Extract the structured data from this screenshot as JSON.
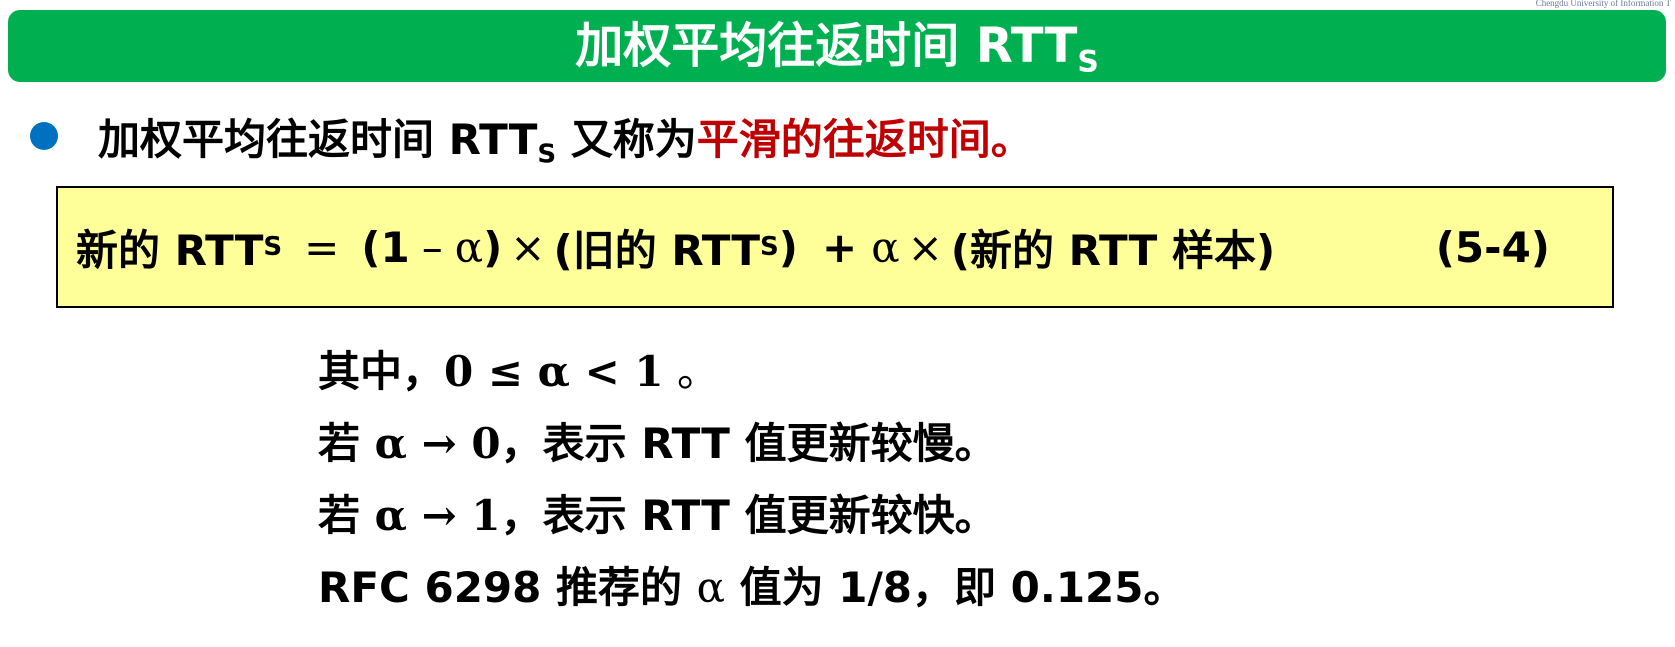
{
  "logo": {
    "text": "Chengdu University of Information T"
  },
  "title": {
    "main": "加权平均往返时间 RTT",
    "subscript": "S"
  },
  "bullet": {
    "prefix": "加权平均往返时间 RTT",
    "subscript": "S",
    "middle": " 又称为",
    "highlight": "平滑的往返时间。",
    "highlight_color": "#c00000"
  },
  "formula": {
    "lhs": "新的 RTT",
    "lhs_sub": "S",
    "equals": "=",
    "p1_open": "(1",
    "minus": "–",
    "alpha": "α",
    "p1_close": ")",
    "times": "×",
    "old_open": "(旧的 RTT",
    "old_sub": "S",
    "old_close": ")",
    "plus": "+",
    "new_sample": "(新的 RTT 样本)",
    "eq_number": "(5-4)"
  },
  "notes": {
    "line1": {
      "pre": "其中，",
      "math": "0 ≤ α < 1",
      "post": " 。"
    },
    "line2": {
      "pre": "若 ",
      "math": "α → 0",
      "post": "，表示 RTT 值更新较慢。"
    },
    "line3": {
      "pre": "若 ",
      "math": "α → 1",
      "post": "，表示 RTT 值更新较快。"
    },
    "line4": {
      "pre": "RFC 6298 推荐的 ",
      "math": "α",
      "post": " 值为 1/8，即 0.125。"
    }
  },
  "colors": {
    "title_bar": "#00b050",
    "formula_box": "#ffff99",
    "bullet": "#0070c0"
  }
}
